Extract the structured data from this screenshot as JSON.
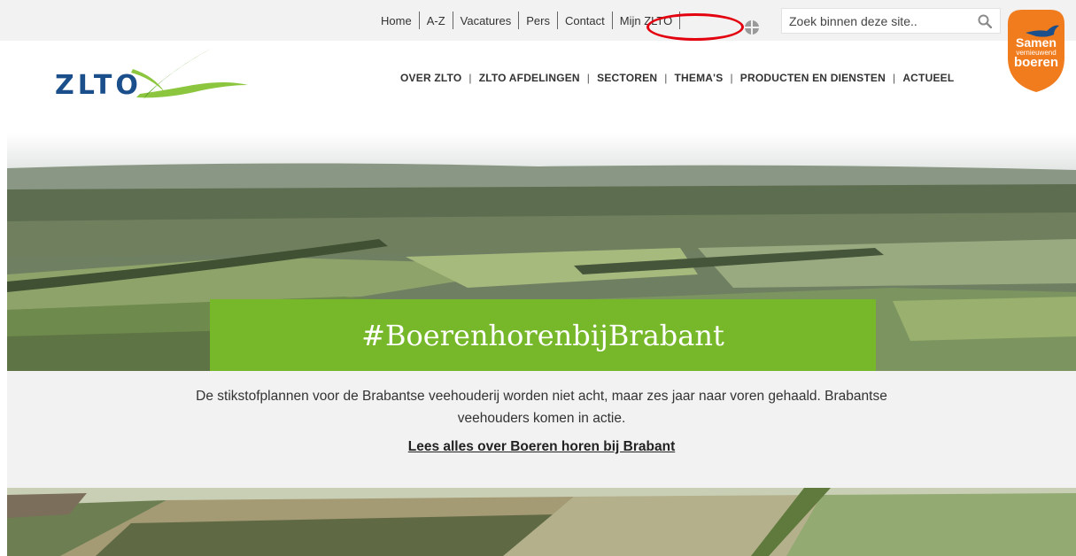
{
  "topnav": {
    "links": [
      "Home",
      "A-Z",
      "Vacatures",
      "Pers",
      "Contact",
      "Mijn ZLTO"
    ]
  },
  "search": {
    "placeholder": "Zoek binnen deze site.."
  },
  "badge": {
    "line1": "Samen",
    "line2": "vernieuwend",
    "line3": "boeren"
  },
  "logo": {
    "text": "ZLTO"
  },
  "mainnav": {
    "items": [
      "OVER ZLTO",
      "ZLTO AFDELINGEN",
      "SECTOREN",
      "THEMA'S",
      "PRODUCTEN EN DIENSTEN",
      "ACTUEEL"
    ]
  },
  "hero": {
    "title": "#BoerenhorenbijBrabant",
    "description": "De stikstofplannen voor de Brabantse veehouderij worden niet acht, maar zes jaar naar voren gehaald. Brabantse veehouders komen in actie.",
    "link": "Lees alles over Boeren horen bij Brabant"
  },
  "colors": {
    "brand_green": "#76b82a",
    "logo_blue": "#1a4f8b",
    "badge_orange": "#f07c1e",
    "highlight_red": "#e3000f"
  }
}
